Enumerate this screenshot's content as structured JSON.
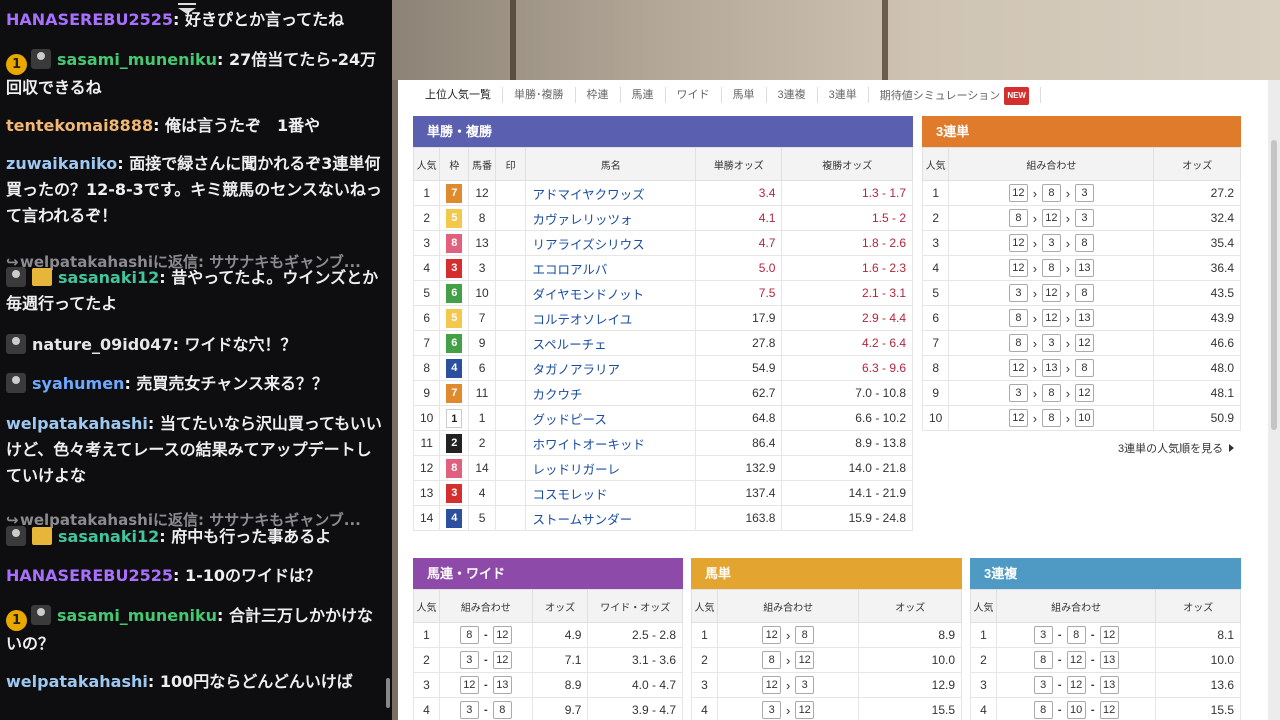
{
  "chat": {
    "messages": [
      {
        "user": "HANASEREBU2525",
        "color": "#a970ff",
        "badges": [],
        "text": "好きぴとか言ってたね"
      },
      {
        "user": "sasami_muneniku",
        "color": "#46c872",
        "badges": [
          "1",
          "a"
        ],
        "text": "27倍当てたら-24万回収できるね"
      },
      {
        "user": "tentekomai8888",
        "color": "#f0b775",
        "badges": [],
        "text": "俺は言うたぞ　1番や"
      },
      {
        "user": "zuwaikaniko",
        "color": "#9ec8f2",
        "badges": [],
        "text": "面接で緑さんに聞かれるぞ3連単何買ったの？12-8-3です。キミ競馬のセンスないねって言われるぞ！"
      },
      {
        "reply": "welpatakahashiに返信: ササナキもギャンブ..."
      },
      {
        "user": "sasanaki12",
        "color": "#42c59a",
        "badges": [
          "a",
          "b"
        ],
        "text": "昔やってたよ。ウインズとか毎週行ってたよ"
      },
      {
        "user": "nature_09id047",
        "color": "#e6e6e6",
        "badges": [
          "a"
        ],
        "text": "ワイドな穴！？"
      },
      {
        "user": "syahumen",
        "color": "#6ea8ff",
        "badges": [
          "a"
        ],
        "text": "売買売女チャンス来る？？"
      },
      {
        "user": "welpatakahashi",
        "color": "#9ec8f2",
        "badges": [],
        "text": "当てたいなら沢山買ってもいいけど、色々考えてレースの結果みてアップデートしていけよな"
      },
      {
        "reply": "welpatakahashiに返信: ササナキもギャンブ..."
      },
      {
        "user": "sasanaki12",
        "color": "#42c59a",
        "badges": [
          "a",
          "b"
        ],
        "text": "府中も行った事あるよ"
      },
      {
        "user": "HANASEREBU2525",
        "color": "#a970ff",
        "badges": [],
        "text": "1-10のワイドは？"
      },
      {
        "user": "sasami_muneniku",
        "color": "#46c872",
        "badges": [
          "1",
          "a"
        ],
        "text": "合計三万しかかけないの？"
      },
      {
        "user": "welpatakahashi",
        "color": "#9ec8f2",
        "badges": [],
        "text": "100円ならどんどんいけば"
      }
    ]
  },
  "tabs": [
    "上位人気一覧",
    "単勝･複勝",
    "枠連",
    "馬連",
    "ワイド",
    "馬単",
    "3連複",
    "3連単",
    "期待値シミュレーション"
  ],
  "tab_new_badge": "NEW",
  "tansho": {
    "title": "単勝・複勝",
    "color": "#5a5fb0",
    "headers": [
      "人気",
      "枠",
      "馬番",
      "印",
      "馬名",
      "単勝オッズ",
      "複勝オッズ"
    ],
    "rows": [
      {
        "rank": "1",
        "waku": "7",
        "waku_color": "#e08a2e",
        "num": "12",
        "name": "アドマイヤクワッズ",
        "win": "3.4",
        "place": "1.3 - 1.7",
        "hot": true
      },
      {
        "rank": "2",
        "waku": "5",
        "waku_color": "#f2c94c",
        "num": "8",
        "name": "カヴァレリッツォ",
        "win": "4.1",
        "place": "1.5 - 2",
        "hot": true
      },
      {
        "rank": "3",
        "waku": "8",
        "waku_color": "#e0607e",
        "num": "13",
        "name": "リアライズシリウス",
        "win": "4.7",
        "place": "1.8 - 2.6",
        "hot": true
      },
      {
        "rank": "4",
        "waku": "3",
        "waku_color": "#d32f2f",
        "num": "3",
        "name": "エコロアルバ",
        "win": "5.0",
        "place": "1.6 - 2.3",
        "hot": true
      },
      {
        "rank": "5",
        "waku": "6",
        "waku_color": "#43a047",
        "num": "10",
        "name": "ダイヤモンドノット",
        "win": "7.5",
        "place": "2.1 - 3.1",
        "hot": true
      },
      {
        "rank": "6",
        "waku": "5",
        "waku_color": "#f2c94c",
        "num": "7",
        "name": "コルテオソレイユ",
        "win": "17.9",
        "place": "2.9 - 4.4",
        "hot": false,
        "place_hot": true
      },
      {
        "rank": "7",
        "waku": "6",
        "waku_color": "#43a047",
        "num": "9",
        "name": "スペルーチェ",
        "win": "27.8",
        "place": "4.2 - 6.4",
        "hot": false,
        "place_hot": true
      },
      {
        "rank": "8",
        "waku": "4",
        "waku_color": "#2c4fa0",
        "num": "6",
        "name": "タガノアラリア",
        "win": "54.9",
        "place": "6.3 - 9.6",
        "hot": false,
        "place_hot": true
      },
      {
        "rank": "9",
        "waku": "7",
        "waku_color": "#e08a2e",
        "num": "11",
        "name": "カクウチ",
        "win": "62.7",
        "place": "7.0 - 10.8",
        "hot": false
      },
      {
        "rank": "10",
        "waku": "1",
        "waku_color": "#ffffff",
        "num": "1",
        "name": "グッドピース",
        "win": "64.8",
        "place": "6.6 - 10.2",
        "hot": false
      },
      {
        "rank": "11",
        "waku": "2",
        "waku_color": "#222222",
        "num": "2",
        "name": "ホワイトオーキッド",
        "win": "86.4",
        "place": "8.9 - 13.8",
        "hot": false
      },
      {
        "rank": "12",
        "waku": "8",
        "waku_color": "#e0607e",
        "num": "14",
        "name": "レッドリガーレ",
        "win": "132.9",
        "place": "14.0 - 21.8",
        "hot": false
      },
      {
        "rank": "13",
        "waku": "3",
        "waku_color": "#d32f2f",
        "num": "4",
        "name": "コスモレッド",
        "win": "137.4",
        "place": "14.1 - 21.9",
        "hot": false
      },
      {
        "rank": "14",
        "waku": "4",
        "waku_color": "#2c4fa0",
        "num": "5",
        "name": "ストームサンダー",
        "win": "163.8",
        "place": "15.9 - 24.8",
        "hot": false
      }
    ]
  },
  "sanrentan": {
    "title": "3連単",
    "color": "#e07b2c",
    "headers": [
      "人気",
      "組み合わせ",
      "オッズ"
    ],
    "rows": [
      {
        "rank": "1",
        "combo": [
          "12",
          "8",
          "3"
        ],
        "odds": "27.2"
      },
      {
        "rank": "2",
        "combo": [
          "8",
          "12",
          "3"
        ],
        "odds": "32.4"
      },
      {
        "rank": "3",
        "combo": [
          "12",
          "3",
          "8"
        ],
        "odds": "35.4"
      },
      {
        "rank": "4",
        "combo": [
          "12",
          "8",
          "13"
        ],
        "odds": "36.4"
      },
      {
        "rank": "5",
        "combo": [
          "3",
          "12",
          "8"
        ],
        "odds": "43.5"
      },
      {
        "rank": "6",
        "combo": [
          "8",
          "12",
          "13"
        ],
        "odds": "43.9"
      },
      {
        "rank": "7",
        "combo": [
          "8",
          "3",
          "12"
        ],
        "odds": "46.6"
      },
      {
        "rank": "8",
        "combo": [
          "12",
          "13",
          "8"
        ],
        "odds": "48.0"
      },
      {
        "rank": "9",
        "combo": [
          "3",
          "8",
          "12"
        ],
        "odds": "48.1"
      },
      {
        "rank": "10",
        "combo": [
          "12",
          "8",
          "10"
        ],
        "odds": "50.9"
      }
    ],
    "more_link": "3連単の人気順を見る"
  },
  "umaren": {
    "title": "馬連・ワイド",
    "color": "#8e4aa8",
    "headers": [
      "人気",
      "組み合わせ",
      "オッズ",
      "ワイド・オッズ"
    ],
    "rows": [
      {
        "rank": "1",
        "combo": [
          "8",
          "12"
        ],
        "odds": "4.9",
        "wide": "2.5 - 2.8"
      },
      {
        "rank": "2",
        "combo": [
          "3",
          "12"
        ],
        "odds": "7.1",
        "wide": "3.1 - 3.6"
      },
      {
        "rank": "3",
        "combo": [
          "12",
          "13"
        ],
        "odds": "8.9",
        "wide": "4.0 - 4.7"
      },
      {
        "rank": "4",
        "combo": [
          "3",
          "8"
        ],
        "odds": "9.7",
        "wide": "3.9 - 4.7"
      }
    ]
  },
  "umatan": {
    "title": "馬単",
    "color": "#e3a430",
    "headers": [
      "人気",
      "組み合わせ",
      "オッズ"
    ],
    "rows": [
      {
        "rank": "1",
        "combo": [
          "12",
          "8"
        ],
        "odds": "8.9"
      },
      {
        "rank": "2",
        "combo": [
          "8",
          "12"
        ],
        "odds": "10.0"
      },
      {
        "rank": "3",
        "combo": [
          "12",
          "3"
        ],
        "odds": "12.9"
      },
      {
        "rank": "4",
        "combo": [
          "3",
          "12"
        ],
        "odds": "15.5"
      }
    ]
  },
  "sanrenpuku": {
    "title": "3連複",
    "color": "#4e9ac4",
    "headers": [
      "人気",
      "組み合わせ",
      "オッズ"
    ],
    "rows": [
      {
        "rank": "1",
        "combo": [
          "3",
          "8",
          "12"
        ],
        "odds": "8.1"
      },
      {
        "rank": "2",
        "combo": [
          "8",
          "12",
          "13"
        ],
        "odds": "10.0"
      },
      {
        "rank": "3",
        "combo": [
          "3",
          "12",
          "13"
        ],
        "odds": "13.6"
      },
      {
        "rank": "4",
        "combo": [
          "8",
          "10",
          "12"
        ],
        "odds": "15.5"
      }
    ]
  }
}
